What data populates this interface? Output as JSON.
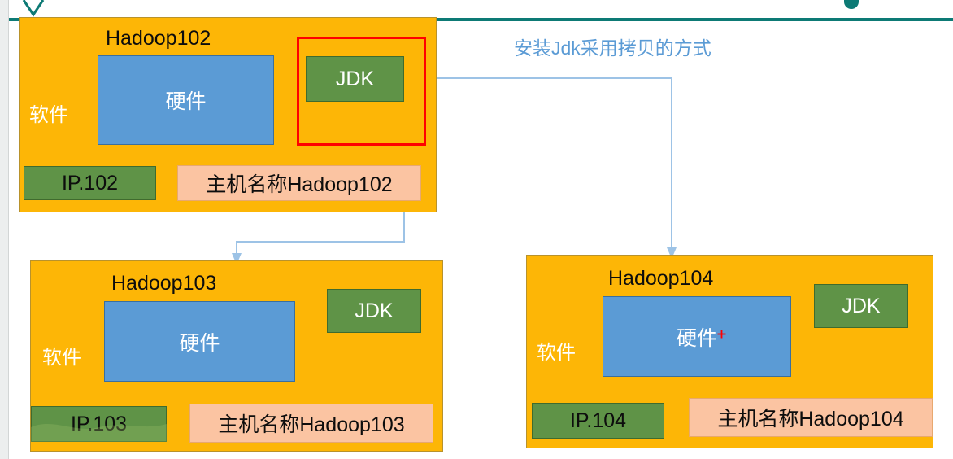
{
  "page": {
    "background": "#ffffff",
    "gutter_color": "#eceeee"
  },
  "header": {
    "rule_color": "#0d7a75",
    "chevron_icon": "chevron-down-icon",
    "marker_icon": "teal-dot-marker"
  },
  "palette": {
    "host_fill": "#FDB606",
    "host_border": "#b8922c",
    "hardware_fill": "#5B9BD5",
    "hardware_border": "#3a6f9e",
    "jdk_fill": "#5F9347",
    "jdk_border": "#3f6b2e",
    "hostname_fill": "#FBC4A2",
    "hostname_border": "#e8a86f",
    "highlight_red": "#FF0000",
    "connector_blue": "#9DC3E6",
    "annotation_blue": "#5B9BD5",
    "teal": "#0d7a75"
  },
  "annotation": {
    "text": "安装Jdk采用拷贝的方式"
  },
  "hosts": [
    {
      "id": "hadoop102",
      "title": "Hadoop102",
      "software_label": "软件",
      "hardware_label": "硬件",
      "jdk_label": "JDK",
      "ip_label": "IP.102",
      "hostname_label": "主机名称Hadoop102",
      "highlighted": true
    },
    {
      "id": "hadoop103",
      "title": "Hadoop103",
      "software_label": "软件",
      "hardware_label": "硬件",
      "jdk_label": "JDK",
      "ip_label": "IP.103",
      "hostname_label": "主机名称Hadoop103",
      "highlighted": false
    },
    {
      "id": "hadoop104",
      "title": "Hadoop104",
      "software_label": "软件",
      "hardware_label": "硬件",
      "jdk_label": "JDK",
      "ip_label": "IP.104",
      "hostname_label": "主机名称Hadoop104",
      "highlighted": false
    }
  ],
  "connectors": [
    {
      "id": "jdk-to-hadoop104",
      "from": "hadoop102-jdk",
      "to": "hadoop104"
    },
    {
      "id": "jdk-to-hadoop103",
      "from": "hadoop102-jdk",
      "to": "hadoop103"
    }
  ],
  "cursor_mark": {
    "glyph": "+",
    "color": "#FF0000"
  }
}
